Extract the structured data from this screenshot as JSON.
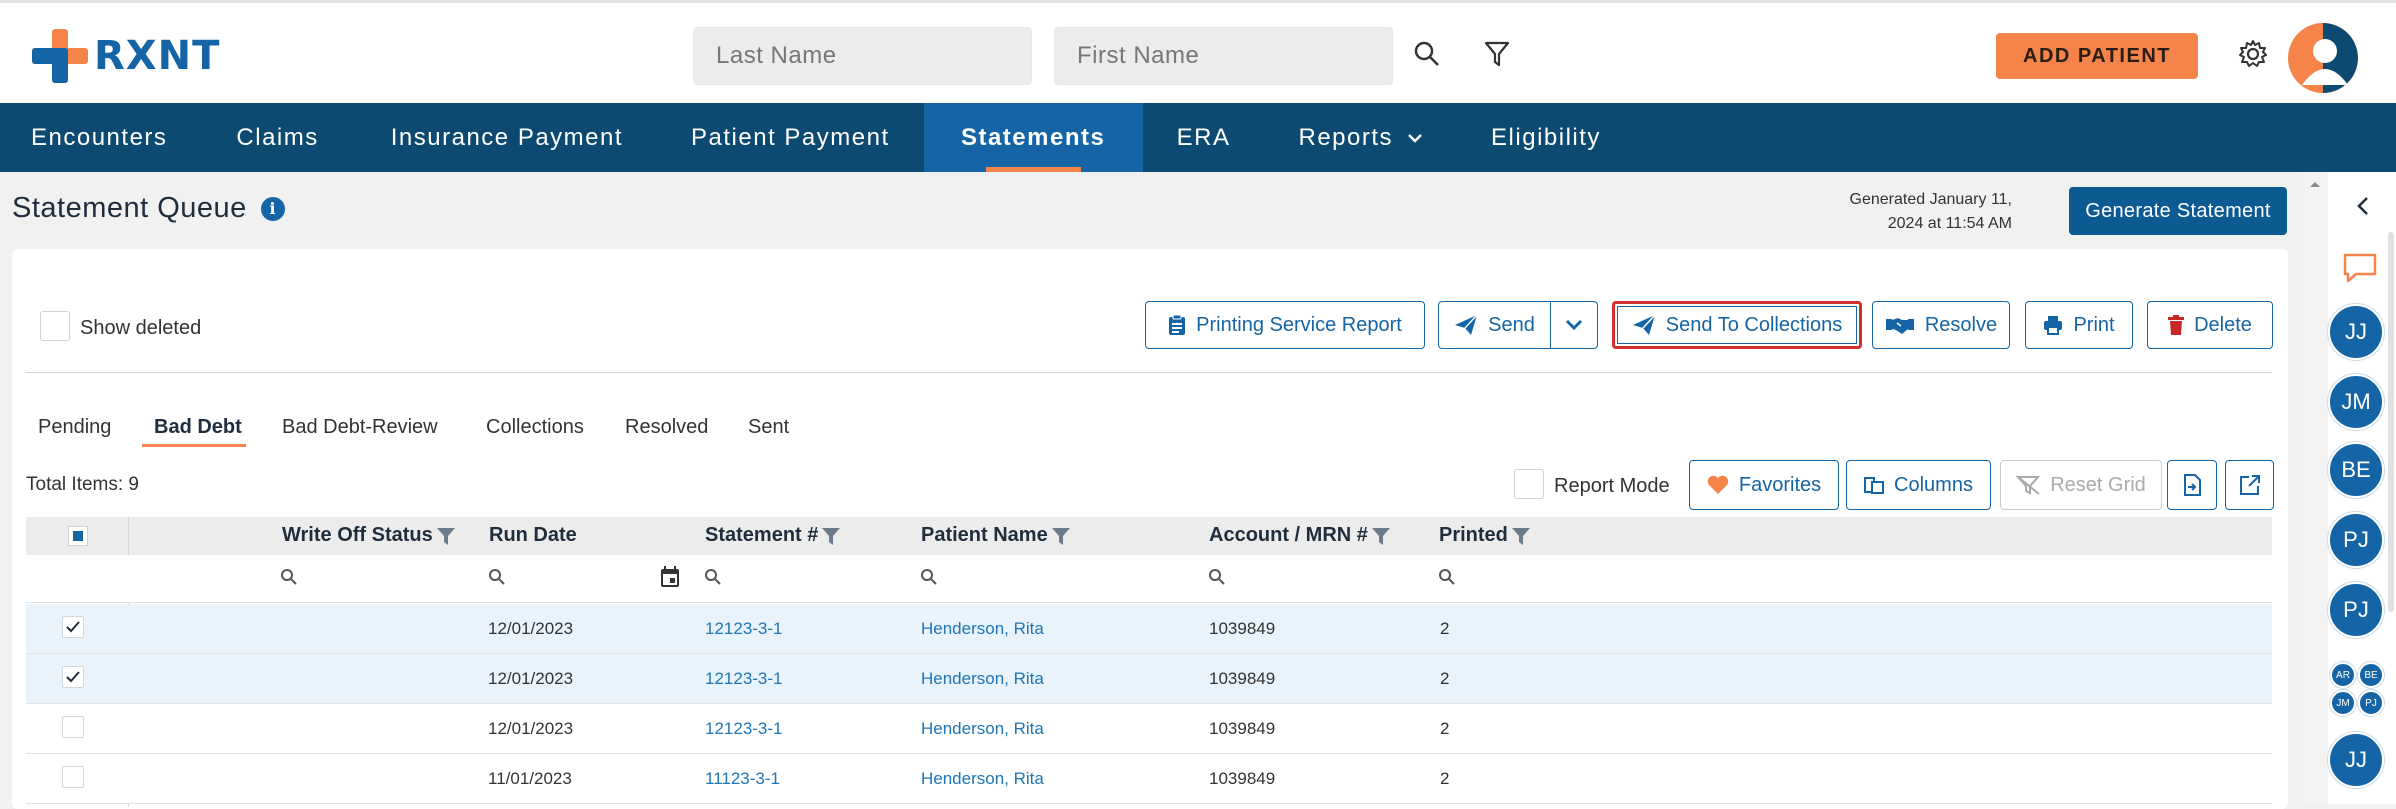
{
  "brand": {
    "name": "RXNT",
    "orange": "#f5844b",
    "blue": "#1565a6",
    "navy": "#0c4a71"
  },
  "search": {
    "last_placeholder": "Last Name",
    "first_placeholder": "First Name"
  },
  "header": {
    "add_patient": "ADD PATIENT"
  },
  "nav": [
    {
      "label": "Encounters"
    },
    {
      "label": "Claims"
    },
    {
      "label": "Insurance Payment"
    },
    {
      "label": "Patient Payment"
    },
    {
      "label": "Statements",
      "active": true
    },
    {
      "label": "ERA"
    },
    {
      "label": "Reports",
      "dropdown": true
    },
    {
      "label": "Eligibility"
    }
  ],
  "page": {
    "title": "Statement Queue",
    "generated_line1": "Generated January 11,",
    "generated_line2": "2024 at 11:54 AM",
    "generate_button": "Generate Statement"
  },
  "toolbar": {
    "show_deleted": "Show deleted",
    "printing_report": "Printing Service Report",
    "send": "Send",
    "send_collections": "Send To Collections",
    "resolve": "Resolve",
    "print": "Print",
    "delete": "Delete"
  },
  "tabs": [
    "Pending",
    "Bad Debt",
    "Bad Debt-Review",
    "Collections",
    "Resolved",
    "Sent"
  ],
  "grid": {
    "total": "Total Items: 9",
    "report_mode": "Report Mode",
    "favorites": "Favorites",
    "columns": "Columns",
    "reset": "Reset Grid",
    "headers": [
      "Write Off Status",
      "Run Date",
      "Statement #",
      "Patient Name",
      "Account / MRN #",
      "Printed"
    ],
    "rows": [
      {
        "checked": true,
        "run_date": "12/01/2023",
        "statement": "12123-3-1",
        "patient": "Henderson, Rita",
        "account": "1039849",
        "printed": "2"
      },
      {
        "checked": true,
        "run_date": "12/01/2023",
        "statement": "12123-3-1",
        "patient": "Henderson, Rita",
        "account": "1039849",
        "printed": "2"
      },
      {
        "checked": false,
        "run_date": "12/01/2023",
        "statement": "12123-3-1",
        "patient": "Henderson, Rita",
        "account": "1039849",
        "printed": "2"
      },
      {
        "checked": false,
        "run_date": "11/01/2023",
        "statement": "11123-3-1",
        "patient": "Henderson, Rita",
        "account": "1039849",
        "printed": "2"
      }
    ]
  },
  "chat": {
    "users": [
      "JJ",
      "JM",
      "BE",
      "PJ",
      "PJ"
    ],
    "group": [
      "AR",
      "BE",
      "JM",
      "PJ"
    ],
    "last": "JJ"
  }
}
